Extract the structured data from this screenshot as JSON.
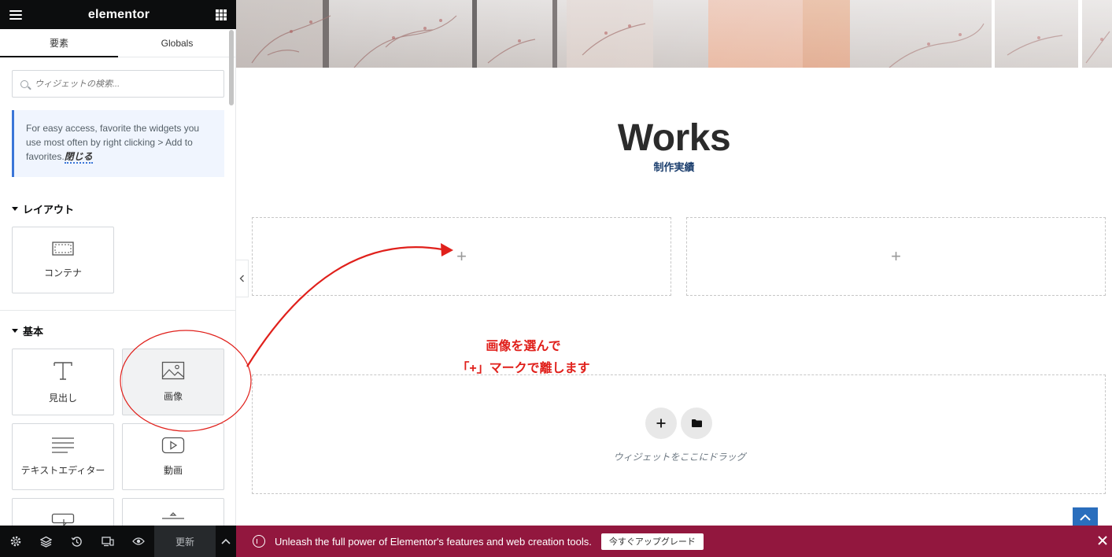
{
  "panel": {
    "brand": "elementor",
    "tabs": [
      {
        "label": "要素",
        "active": true
      },
      {
        "label": "Globals",
        "active": false
      }
    ],
    "search": {
      "placeholder": "ウィジェットの検索...",
      "value": ""
    },
    "notice": {
      "text": "For easy access, favorite the widgets you use most often by right clicking > Add to favorites.",
      "close_link": "閉じる"
    },
    "sections": [
      {
        "title": "レイアウト",
        "widgets": [
          {
            "label": "コンテナ",
            "icon": "container-icon"
          }
        ]
      },
      {
        "title": "基本",
        "widgets": [
          {
            "label": "見出し",
            "icon": "heading-icon"
          },
          {
            "label": "画像",
            "icon": "image-icon"
          },
          {
            "label": "テキストエディター",
            "icon": "text-editor-icon"
          },
          {
            "label": "動画",
            "icon": "video-icon"
          }
        ]
      }
    ],
    "footer": {
      "icons": [
        "settings-icon",
        "layers-icon",
        "history-icon",
        "responsive-icon",
        "preview-icon"
      ],
      "update_label": "更新"
    }
  },
  "canvas": {
    "title": "Works",
    "subtitle": "制作実績",
    "annotation": {
      "line1": "画像を選んで",
      "line2": "「+」マークで離します"
    },
    "column_plus": "+",
    "drop_area": {
      "text": "ウィジェットをここにドラッグ"
    }
  },
  "promo": {
    "message": "Unleash the full power of Elementor's features and web creation tools.",
    "cta": "今すぐアップグレード"
  },
  "colors": {
    "panel_dark": "#0c0d0e",
    "notice_bg": "#f0f5fe",
    "notice_border": "#3a76d8",
    "annotation_red": "#e0201b",
    "promo_bg": "#92173e",
    "subtitle_blue": "#1c3f6e",
    "scroll_top_blue": "#2a6ebd"
  }
}
